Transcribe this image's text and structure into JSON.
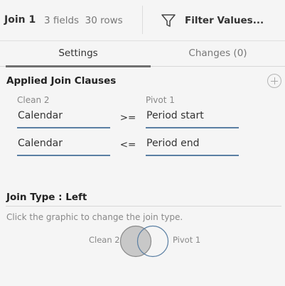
{
  "header": {
    "step_name": "Join 1",
    "meta": "3 fields  30 rows",
    "filter_label": "Filter Values..."
  },
  "tabs": [
    {
      "label": "Settings",
      "selected": true
    },
    {
      "label": "Changes (0)",
      "selected": false
    }
  ],
  "join_clauses": {
    "title": "Applied Join Clauses",
    "left_source": "Clean 2",
    "right_source": "Pivot 1",
    "clauses": [
      {
        "left": "Calendar",
        "operator": ">=",
        "right": "Period start"
      },
      {
        "left": "Calendar",
        "operator": "<=",
        "right": "Period end"
      }
    ]
  },
  "join_type": {
    "title": "Join Type : Left",
    "hint": "Click the graphic to change the join type.",
    "left_label": "Clean 2",
    "right_label": "Pivot 1",
    "type": "left",
    "colors": {
      "selected_fill": "#c8c8c8",
      "left_stroke": "#8a8a8a",
      "right_stroke": "#5a7fa3"
    }
  }
}
